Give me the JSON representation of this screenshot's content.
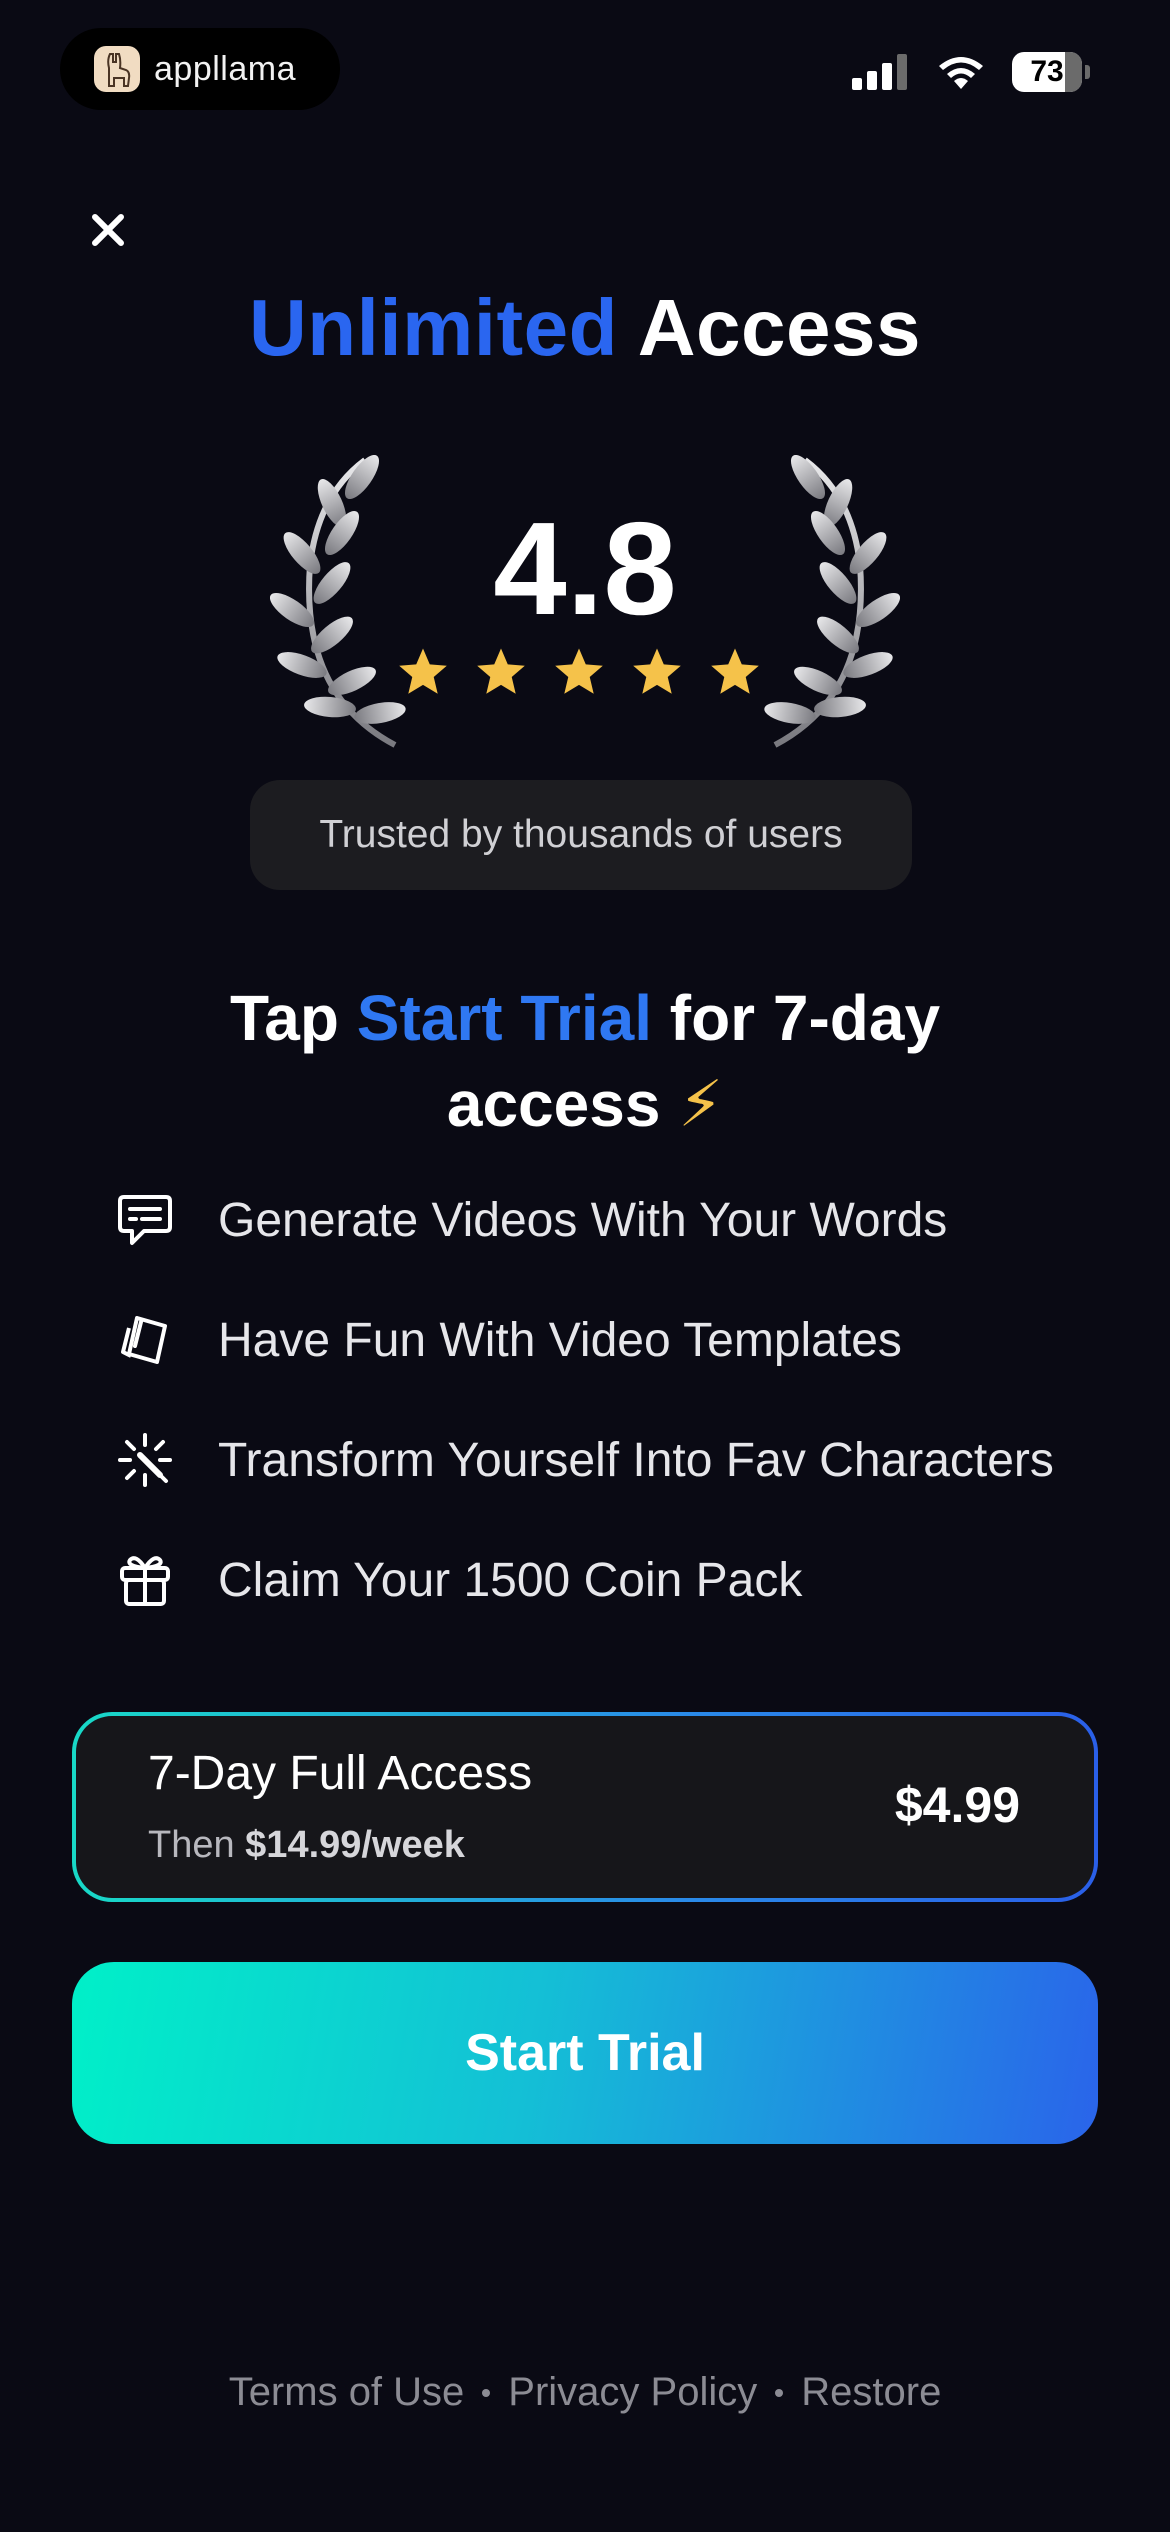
{
  "status_bar": {
    "app_name": "appllama",
    "battery_level": "73"
  },
  "header": {
    "close_icon": "close-icon",
    "title_accent": "Unlimited",
    "title_rest": " Access"
  },
  "rating": {
    "value": "4.8",
    "stars": 5,
    "badge_text": "Trusted by thousands of users"
  },
  "headline": {
    "prefix": "Tap ",
    "accent": "Start Trial",
    "suffix": " for 7-day access",
    "emoji": "⚡"
  },
  "features": [
    {
      "icon": "chat-bubble-icon",
      "label": "Generate Videos With Your Words"
    },
    {
      "icon": "layers-icon",
      "label": "Have Fun With Video Templates"
    },
    {
      "icon": "sparkle-icon",
      "label": "Transform Yourself Into Fav Characters"
    },
    {
      "icon": "gift-icon",
      "label": "Claim Your 1500 Coin Pack"
    }
  ],
  "plan": {
    "name": "7-Day Full Access",
    "then_label": "Then ",
    "then_price": "$14.99/week",
    "price": "$4.99"
  },
  "cta": {
    "label": "Start Trial"
  },
  "footer": {
    "terms": "Terms of Use",
    "privacy": "Privacy Policy",
    "restore": "Restore"
  },
  "colors": {
    "background": "#0a0a14",
    "accent": "#2a66f0",
    "star": "#f5c24a",
    "cta_start": "#00f0c8",
    "cta_end": "#2a64ea"
  }
}
